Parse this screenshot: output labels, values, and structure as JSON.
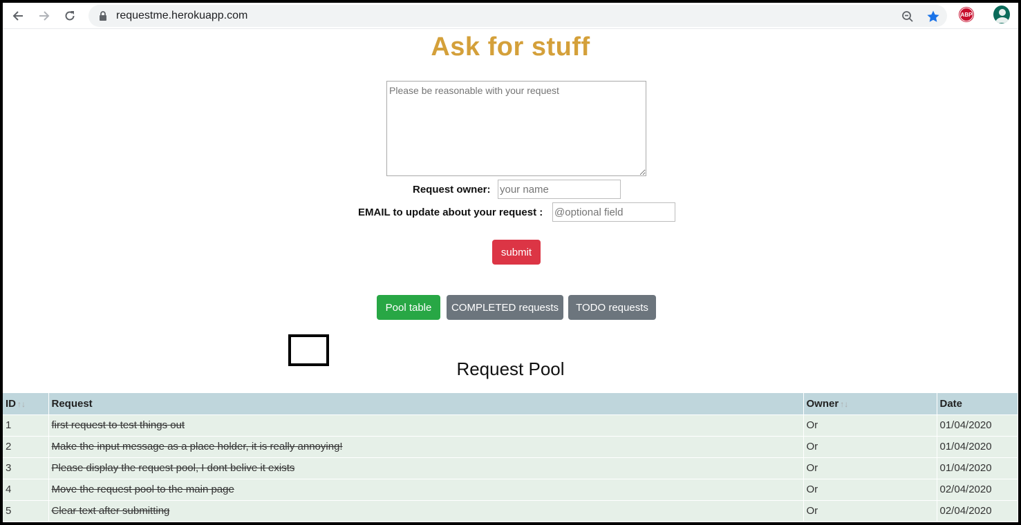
{
  "browser": {
    "url": "requestme.herokuapp.com",
    "abp_label": "ABP"
  },
  "page": {
    "title": "Ask for stuff",
    "request_placeholder": "Please be reasonable with your request",
    "owner_label": "Request owner:",
    "owner_placeholder": "your name",
    "email_label": "EMAIL to update about your request :",
    "email_placeholder": "@optional field",
    "submit_label": "submit",
    "tabs": [
      "Pool table",
      "COMPLETED requests",
      "TODO requests"
    ],
    "pool_heading": "Request Pool"
  },
  "table": {
    "headers": [
      "ID",
      "Request",
      "Owner",
      "Date"
    ],
    "sort_glyph": "↑↓",
    "rows": [
      {
        "id": "1",
        "request": "first request to test things out",
        "owner": "Or",
        "date": "01/04/2020"
      },
      {
        "id": "2",
        "request": "Make the input message as a place holder, it is really annoying!",
        "owner": "Or",
        "date": "01/04/2020"
      },
      {
        "id": "3",
        "request": "Please display the request pool, I dont belive it exists",
        "owner": "Or",
        "date": "01/04/2020"
      },
      {
        "id": "4",
        "request": "Move the request pool to the main page",
        "owner": "Or",
        "date": "02/04/2020"
      },
      {
        "id": "5",
        "request": "Clear text after submitting",
        "owner": "Or",
        "date": "02/04/2020"
      }
    ]
  },
  "colors": {
    "title": "#d4a03a",
    "submit": "#dc3545",
    "pool_tab": "#28a745",
    "secondary_tab": "#6c757d",
    "table_header": "#bfd6dc",
    "table_row": "#e6f0e8"
  }
}
